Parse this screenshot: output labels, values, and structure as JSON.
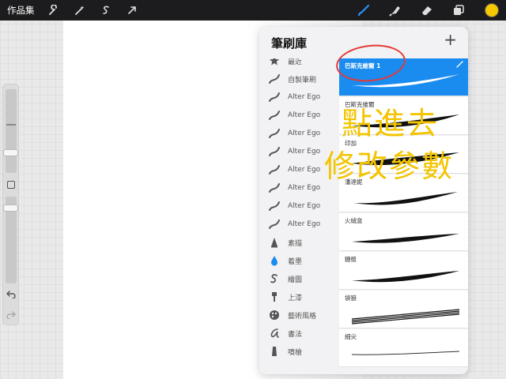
{
  "topbar": {
    "gallery_label": "作品集",
    "left_tools": [
      "wrench-icon",
      "magic-wand-icon",
      "selection-icon",
      "transform-arrow-icon"
    ],
    "right_tools": [
      "brush-icon",
      "smudge-icon",
      "eraser-icon",
      "layers-icon"
    ],
    "active_color": "#f5c800"
  },
  "brush_library": {
    "title": "筆刷庫",
    "add_symbol": "+",
    "categories": [
      {
        "label": "最近",
        "icon": "star-icon"
      },
      {
        "label": "自製筆刷",
        "icon": "stroke-icon"
      },
      {
        "label": "Alter Ego",
        "icon": "stroke-icon"
      },
      {
        "label": "Alter Ego",
        "icon": "stroke-icon"
      },
      {
        "label": "Alter Ego",
        "icon": "stroke-icon"
      },
      {
        "label": "Alter Ego",
        "icon": "stroke-icon"
      },
      {
        "label": "Alter Ego",
        "icon": "stroke-icon"
      },
      {
        "label": "Alter Ego",
        "icon": "stroke-icon"
      },
      {
        "label": "Alter Ego",
        "icon": "stroke-icon"
      },
      {
        "label": "Alter Ego",
        "icon": "stroke-icon"
      },
      {
        "label": "素描",
        "icon": "pencil-tip-icon"
      },
      {
        "label": "着墨",
        "icon": "ink-drop-icon"
      },
      {
        "label": "繪圖",
        "icon": "squiggle-icon"
      },
      {
        "label": "上漆",
        "icon": "paint-brush-icon"
      },
      {
        "label": "藝術風格",
        "icon": "palette-icon"
      },
      {
        "label": "書法",
        "icon": "calligraphy-icon"
      },
      {
        "label": "噴槍",
        "icon": "airbrush-icon"
      }
    ],
    "brushes": [
      {
        "name": "巴斯克維爾 1",
        "selected": true
      },
      {
        "name": "巴斯克維爾",
        "selected": false
      },
      {
        "name": "印加",
        "selected": false
      },
      {
        "name": "潘達妮",
        "selected": false
      },
      {
        "name": "火絨盒",
        "selected": false
      },
      {
        "name": "糖漿",
        "selected": false
      },
      {
        "name": "袋狼",
        "selected": false
      },
      {
        "name": "細尖",
        "selected": false
      }
    ]
  },
  "annotation": {
    "line1": "點進去",
    "line2": "修改參數",
    "color": "#f3c400",
    "circle_color": "#e53935"
  }
}
